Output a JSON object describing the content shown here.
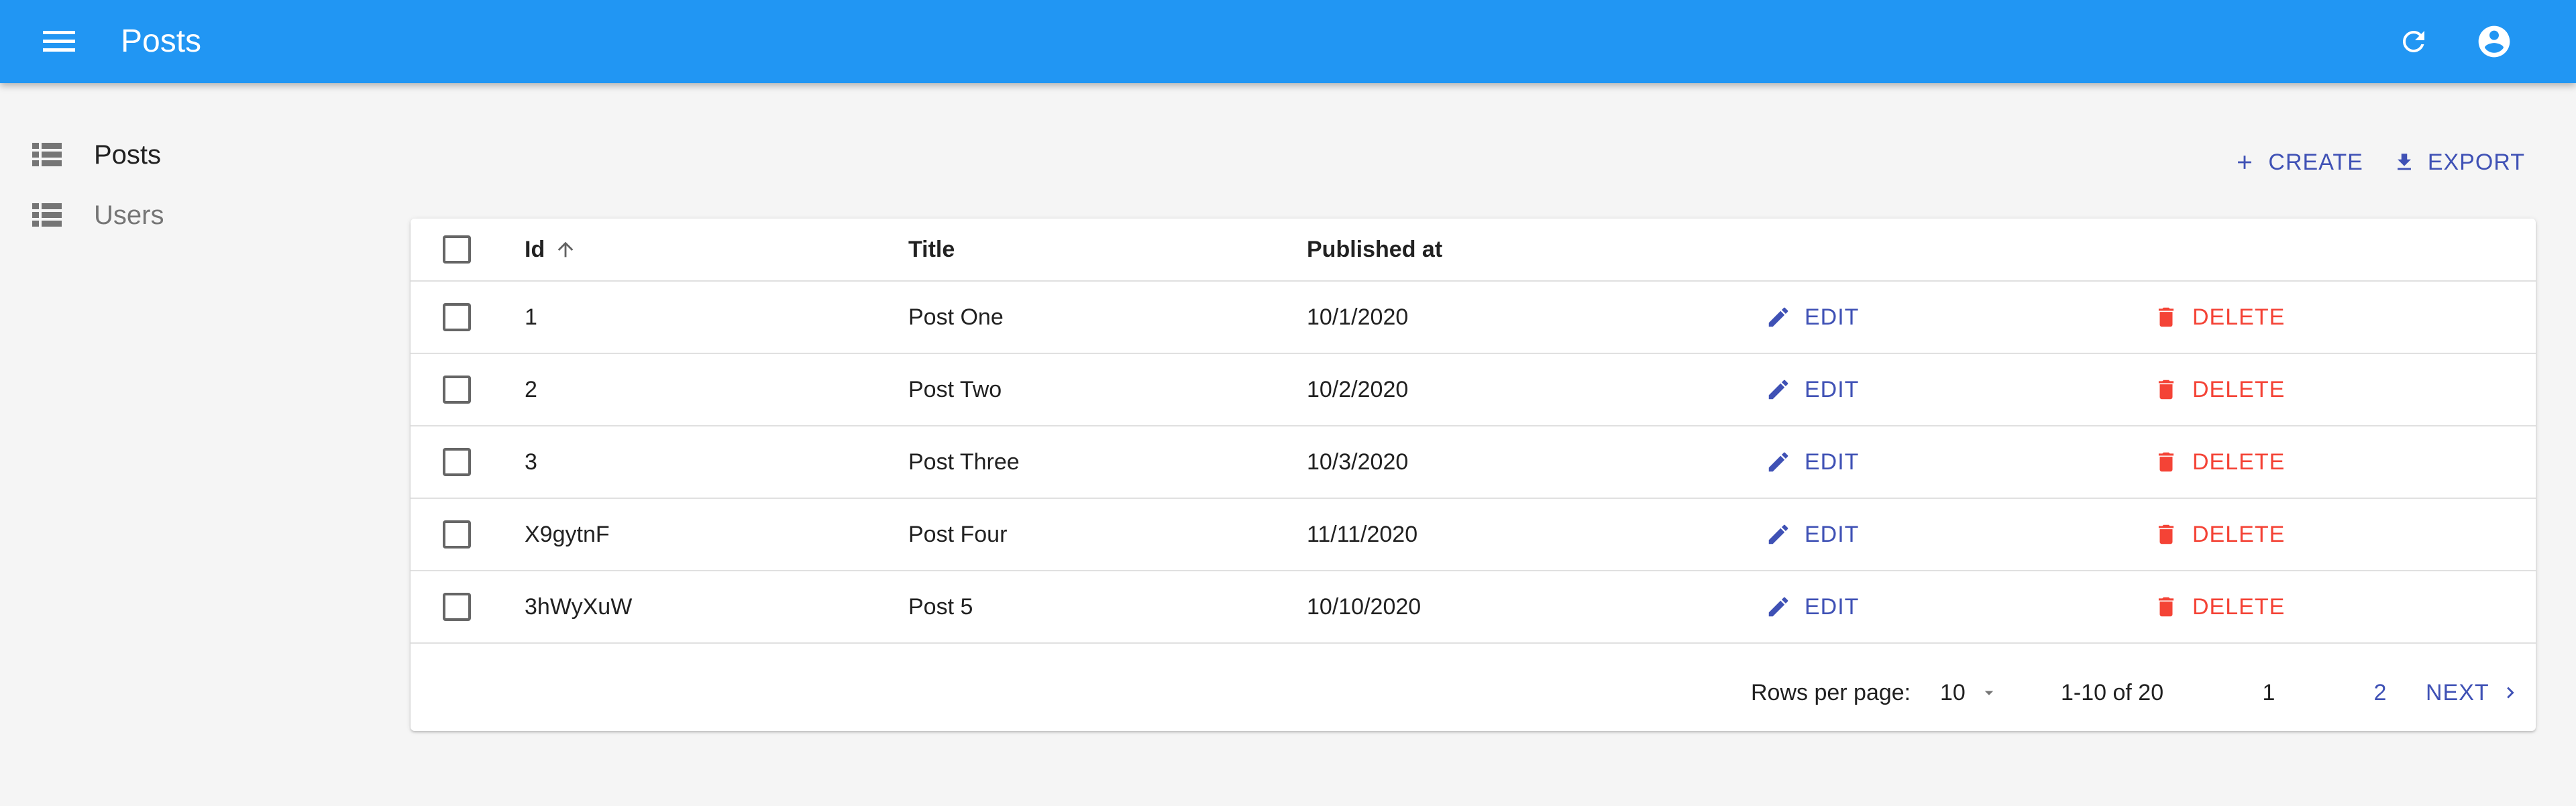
{
  "appbar": {
    "title": "Posts",
    "color": "#2196f3",
    "icons": [
      "menu-icon",
      "refresh-icon",
      "account-circle-icon"
    ]
  },
  "sidebar": {
    "items": [
      {
        "label": "Posts",
        "icon": "list-icon",
        "active": true
      },
      {
        "label": "Users",
        "icon": "list-icon",
        "active": false
      }
    ]
  },
  "actions": {
    "create_label": "CREATE",
    "export_label": "EXPORT"
  },
  "table": {
    "columns": {
      "id": "Id",
      "title": "Title",
      "published_at": "Published at"
    },
    "sort": {
      "column": "Id",
      "direction": "asc"
    },
    "edit_label": "EDIT",
    "delete_label": "DELETE",
    "rows": [
      {
        "id": "1",
        "title": "Post One",
        "published_at": "10/1/2020"
      },
      {
        "id": "2",
        "title": "Post Two",
        "published_at": "10/2/2020"
      },
      {
        "id": "3",
        "title": "Post Three",
        "published_at": "10/3/2020"
      },
      {
        "id": "X9gytnF",
        "title": "Post Four",
        "published_at": "11/11/2020"
      },
      {
        "id": "3hWyXuW",
        "title": "Post 5",
        "published_at": "10/10/2020"
      }
    ]
  },
  "pagination": {
    "rows_per_page_label": "Rows per page:",
    "rows_per_page_value": "10",
    "range": "1-10 of 20",
    "pages": [
      "1",
      "2"
    ],
    "current_page": "1",
    "next_label": "NEXT"
  },
  "colors": {
    "primary": "#3f51b5",
    "danger": "#f44336",
    "appbar": "#2196f3"
  }
}
